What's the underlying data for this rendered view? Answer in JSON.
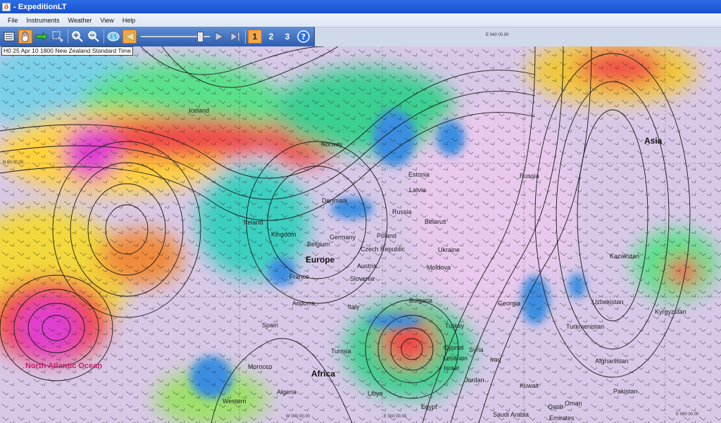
{
  "window": {
    "title": "- ExpeditionLT"
  },
  "menu": [
    "File",
    "Instruments",
    "Weather",
    "View",
    "Help"
  ],
  "toolbar": {
    "buttons": [
      "list-icon",
      "hand-icon",
      "arrow-icon",
      "select-icon",
      "zoom-in-icon",
      "zoom-out-icon",
      "globe-icon",
      "triangle-icon"
    ],
    "play_icon": "play-icon",
    "end_icon": "skip-end-icon",
    "numbers": [
      "1",
      "2",
      "3"
    ],
    "help_icon": "help-icon"
  },
  "forecast": {
    "timestamp": "H0 25 Apr 10 1800 New Zealand Standard Time"
  },
  "map": {
    "continents": [
      "Europe",
      "Africa",
      "Asia"
    ],
    "ocean": "North Atlantic Ocean",
    "countries": [
      "Iceland",
      "Norway",
      "Estonia",
      "Latvia",
      "Russia",
      "Belarus",
      "Denmark",
      "Ireland",
      "Kingdom",
      "Germany",
      "Poland",
      "Belgium",
      "Czech Republic",
      "Ukraine",
      "Austria",
      "Moldova",
      "France",
      "Slovenia",
      "Andorra",
      "Italy",
      "Bulgaria",
      "Georgia",
      "Spain",
      "Turkey",
      "Turkmenistan",
      "Uzbekistan",
      "Kazakstan",
      "Kyrgyzstan",
      "Tunisia",
      "Cyprus",
      "Syria",
      "Lebanon",
      "Israel",
      "Iraq",
      "Jordan",
      "Morocco",
      "Algeria",
      "Libya",
      "Egypt",
      "Western",
      "Kuwait",
      "Saudi Arabia",
      "Qatar",
      "Emirates",
      "Oman",
      "Afghanistan",
      "Pakistan",
      "Russia"
    ],
    "coords": [
      "N 60 00.00",
      "W 000 00.00",
      "E 000 00.00",
      "E 040 00.00",
      "E 060 00.00"
    ]
  }
}
